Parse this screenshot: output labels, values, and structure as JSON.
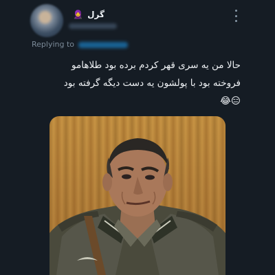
{
  "tweet": {
    "author": {
      "display_name": "گرل",
      "badge_emoji": "🧕"
    },
    "replying_to_label": "Replying to",
    "text_lines": [
      "حالا من یه سری قهر کردم برده بود طلاهامو",
      "فروخته بود با پولشون یه دست دیگه گرفته بود"
    ],
    "emoji_line": "😑😂"
  },
  "icons": {
    "more": "more-vertical-icon",
    "avatar": "avatar-blurred"
  },
  "colors": {
    "background": "#151c24",
    "text": "#eef1f4",
    "muted": "#7b8a98"
  }
}
